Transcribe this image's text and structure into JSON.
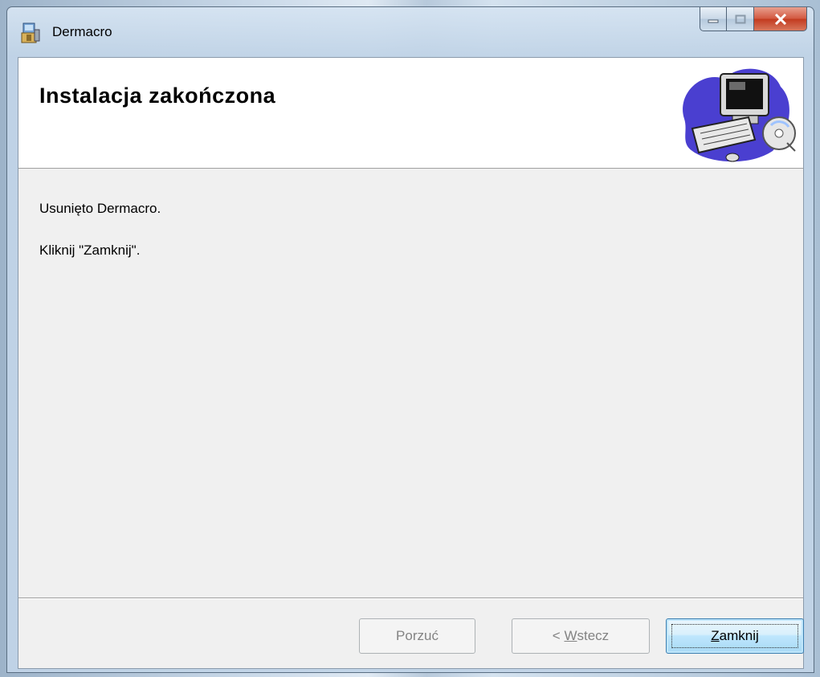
{
  "window": {
    "title": "Dermacro",
    "controls": {
      "minimize": "minimize",
      "maximize": "maximize",
      "close": "close"
    }
  },
  "banner": {
    "title": "Instalacja zakończona",
    "art_icon": "computer-with-disc-icon"
  },
  "body": {
    "line1": "Usunięto Dermacro.",
    "line2": "Kliknij \"Zamknij\"."
  },
  "buttons": {
    "cancel": "Porzuć",
    "back_prefix": "< ",
    "back_mnemonic": "W",
    "back_rest": "stecz",
    "close_mnemonic": "Z",
    "close_rest": "amknij"
  },
  "colors": {
    "close_button_red": "#c23a1f",
    "default_button_blue": "#3c7fb1"
  }
}
